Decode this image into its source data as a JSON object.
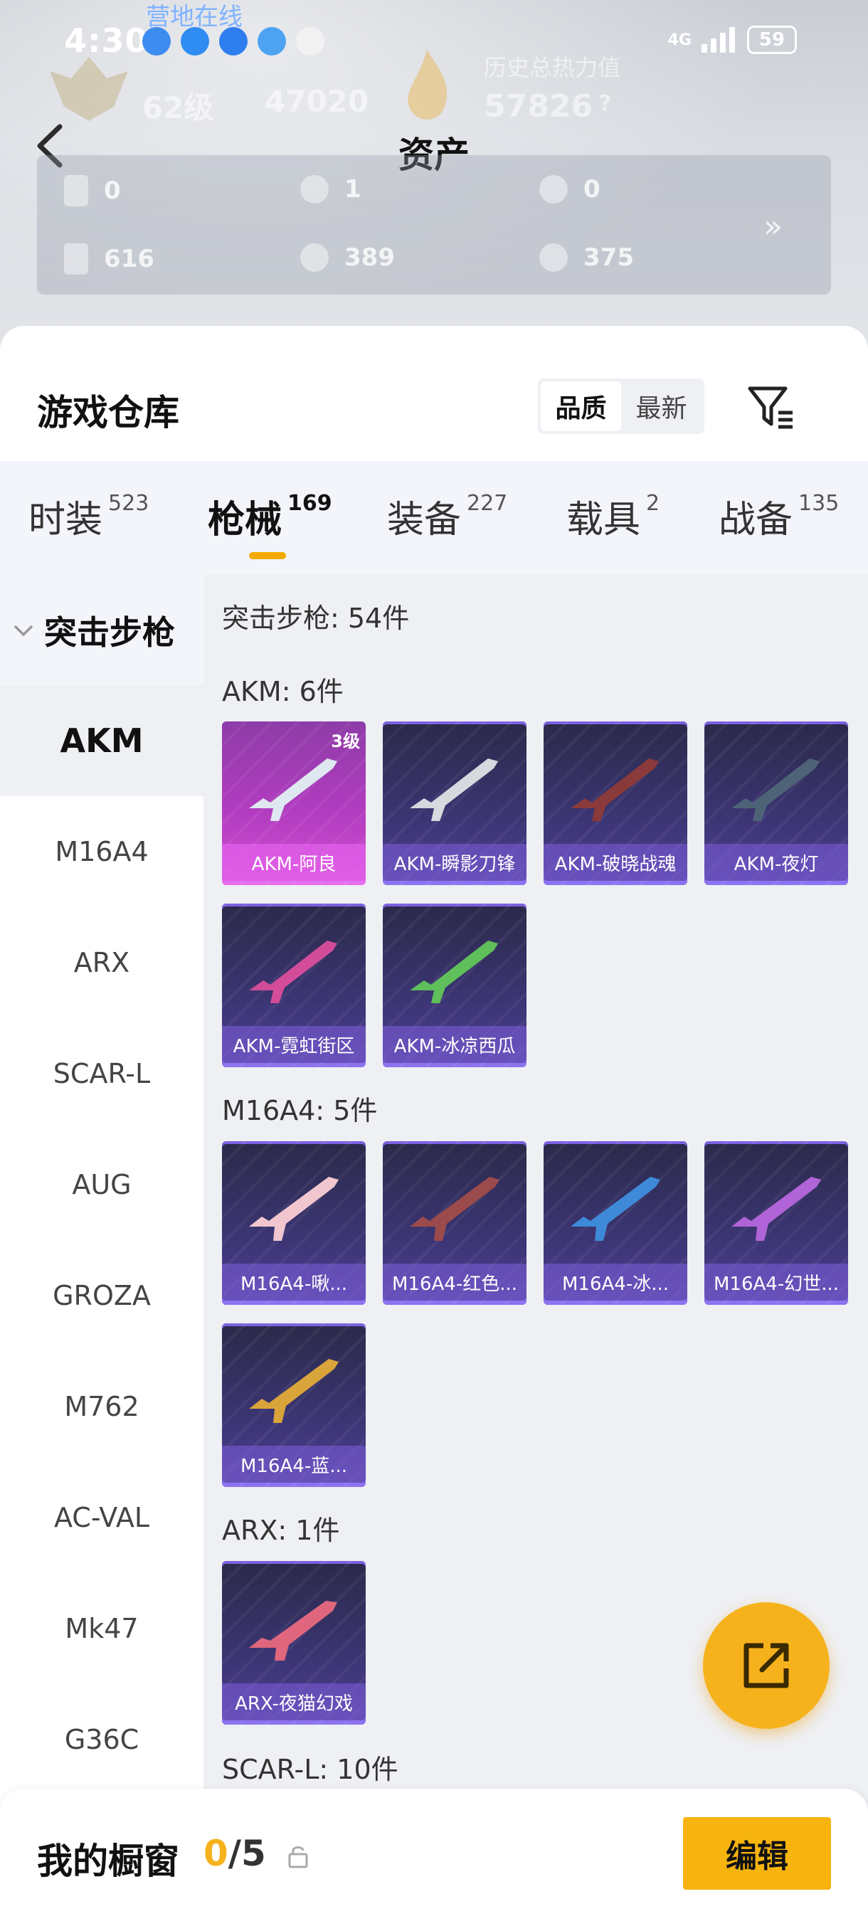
{
  "status_bar": {
    "time": "4:30",
    "network": "4G",
    "battery": "59",
    "online_label": "营地在线"
  },
  "profile_bg": {
    "level": "62级",
    "points": "47020",
    "heat_label": "历史总热力值",
    "heat_value": "57826",
    "question": "?"
  },
  "header": {
    "title": "资产"
  },
  "assets": [
    {
      "icon": "card-icon",
      "value": "0"
    },
    {
      "icon": "coin-silver-icon",
      "value": "1"
    },
    {
      "icon": "coin-gold-icon",
      "value": "0"
    },
    {
      "icon": "ticket-icon",
      "value": "616"
    },
    {
      "icon": "medal-icon",
      "value": "389"
    },
    {
      "icon": "bronze-coin-icon",
      "value": "375"
    }
  ],
  "assets_more": "»",
  "warehouse": {
    "title": "游戏仓库",
    "sort_options": [
      "品质",
      "最新"
    ],
    "sort_active": "品质"
  },
  "tabs": [
    {
      "label": "时装",
      "count": "523"
    },
    {
      "label": "枪械",
      "count": "169",
      "active": true
    },
    {
      "label": "装备",
      "count": "227"
    },
    {
      "label": "载具",
      "count": "2"
    },
    {
      "label": "战备",
      "count": "135"
    }
  ],
  "category": {
    "header": "突击步枪",
    "items": [
      "AKM",
      "M16A4",
      "ARX",
      "SCAR-L",
      "AUG",
      "GROZA",
      "M762",
      "AC-VAL",
      "Mk47",
      "G36C"
    ],
    "active": "AKM"
  },
  "content": {
    "summary": "突击步枪: 54件",
    "sections": [
      {
        "title": "AKM: 6件",
        "items": [
          {
            "name": "AKM-阿良",
            "level": "3级",
            "rare": true
          },
          {
            "name": "AKM-瞬影刀锋"
          },
          {
            "name": "AKM-破晓战魂"
          },
          {
            "name": "AKM-夜灯"
          },
          {
            "name": "AKM-霓虹街区"
          },
          {
            "name": "AKM-冰凉西瓜"
          }
        ]
      },
      {
        "title": "M16A4: 5件",
        "items": [
          {
            "name": "M16A4-啾..."
          },
          {
            "name": "M16A4-红色..."
          },
          {
            "name": "M16A4-冰..."
          },
          {
            "name": "M16A4-幻世..."
          },
          {
            "name": "M16A4-蓝..."
          }
        ]
      },
      {
        "title": "ARX: 1件",
        "items": [
          {
            "name": "ARX-夜猫幻戏"
          }
        ]
      },
      {
        "title": "SCAR-L: 10件",
        "items": []
      }
    ]
  },
  "bottom_bar": {
    "title": "我的橱窗",
    "count_current": "0",
    "count_total": "/5",
    "edit_label": "编辑"
  },
  "colors": {
    "accent": "#f6b21c",
    "card_purple": "#3a3470",
    "card_rare": "#b23cc0"
  }
}
